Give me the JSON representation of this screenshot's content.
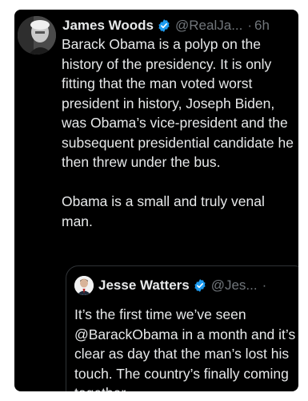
{
  "colors": {
    "background": "#000000",
    "text": "#e7e9ea",
    "muted": "#71767b",
    "verified": "#1d9bf0",
    "border": "#2f3336"
  },
  "tweet": {
    "author_name": "James Woods",
    "handle": "@RealJa...",
    "separator": "·",
    "time": "6h",
    "verified_icon": "verified-badge-icon",
    "text": "Barack Obama is a polyp on the history of the presidency. It is only fitting that the man voted worst president in history, Joseph Biden, was Obama’s vice-president and the subsequent presidential candidate he then threw under the bus.\n\nObama is a small and truly venal man."
  },
  "quoted_tweet": {
    "author_name": "Jesse Watters",
    "handle": "@Jes...",
    "separator": "·",
    "verified_icon": "verified-badge-icon",
    "text": "It’s the first time we’ve seen @BarackObama in a month and it’s clear as day that the man’s lost his touch. The country’s finally coming together"
  }
}
